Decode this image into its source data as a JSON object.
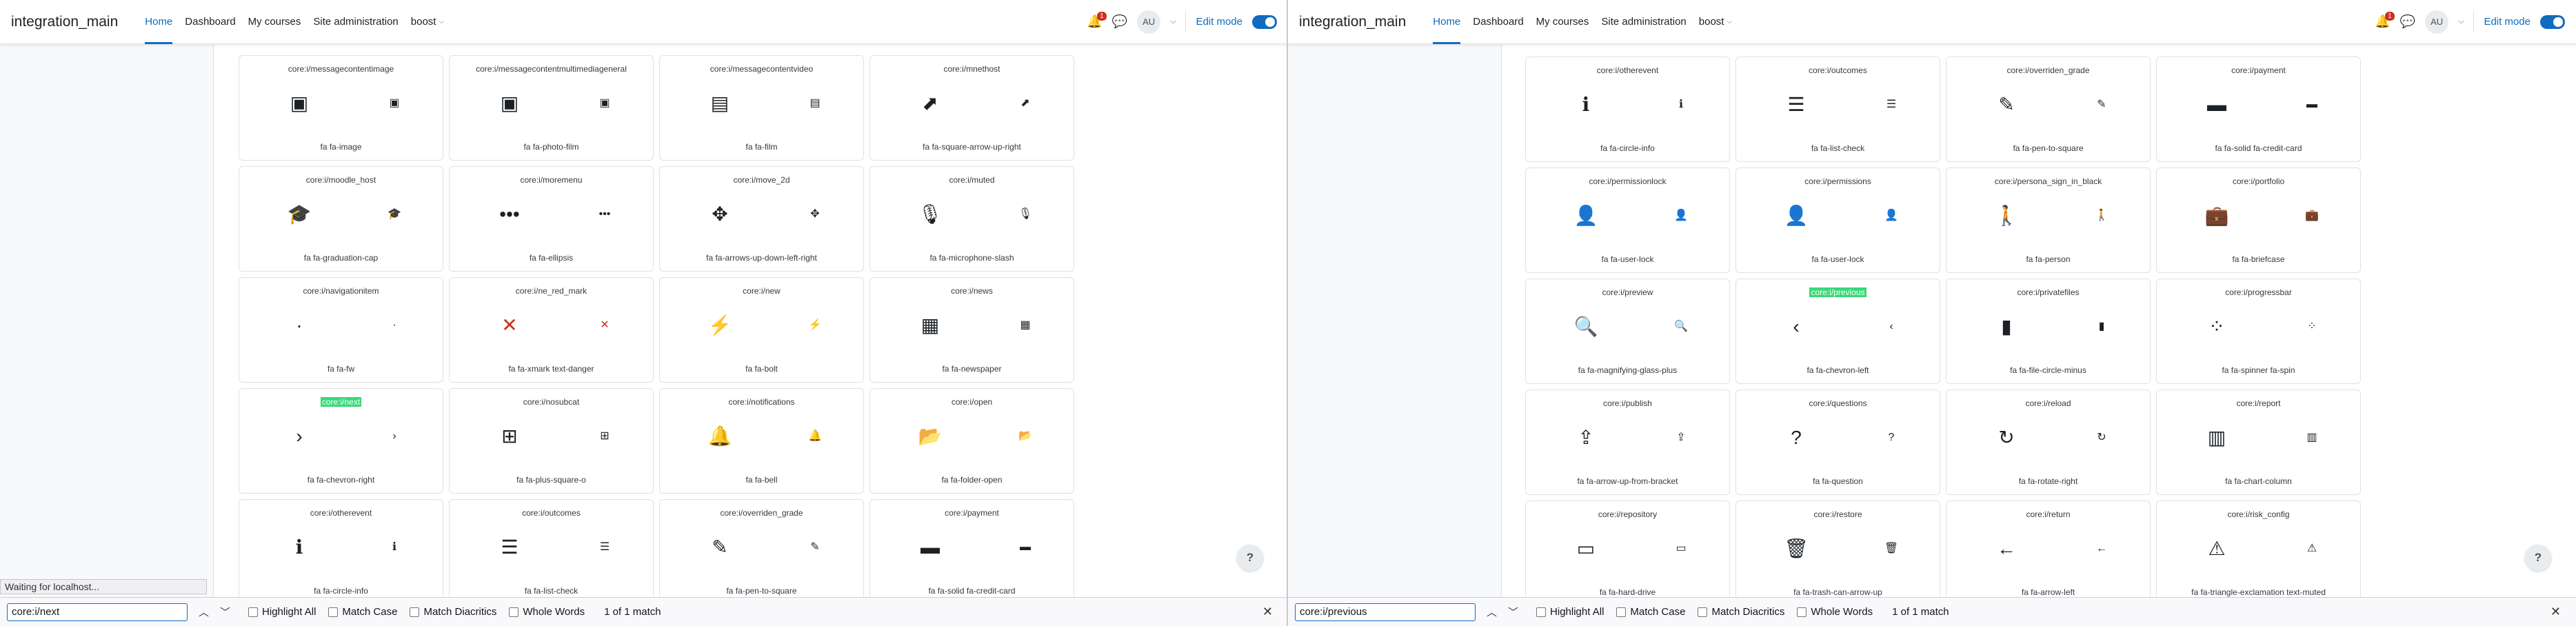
{
  "screens": [
    {
      "navbar": {
        "site_name": "integration_main",
        "items": [
          "Home",
          "Dashboard",
          "My courses",
          "Site administration",
          "boost"
        ],
        "notification_count": "1",
        "avatar_initials": "AU",
        "edit_mode_label": "Edit mode"
      },
      "status_text": "Waiting for localhost...",
      "cards": [
        {
          "name": "core:i/messagecontentimage",
          "fa": "fa fa-image",
          "glyph": "▣"
        },
        {
          "name": "core:i/messagecontentmultimediageneral",
          "fa": "fa fa-photo-film",
          "glyph": "▣"
        },
        {
          "name": "core:i/messagecontentvideo",
          "fa": "fa fa-film",
          "glyph": "▤"
        },
        {
          "name": "core:i/mnethost",
          "fa": "fa fa-square-arrow-up-right",
          "glyph": "⬈"
        },
        {
          "name": "core:i/moodle_host",
          "fa": "fa fa-graduation-cap",
          "glyph": "🎓"
        },
        {
          "name": "core:i/moremenu",
          "fa": "fa fa-ellipsis",
          "glyph": "•••"
        },
        {
          "name": "core:i/move_2d",
          "fa": "fa fa-arrows-up-down-left-right",
          "glyph": "✥"
        },
        {
          "name": "core:i/muted",
          "fa": "fa fa-microphone-slash",
          "glyph": "🎙"
        },
        {
          "name": "core:i/navigationitem",
          "fa": "fa fa-fw",
          "glyph": "·"
        },
        {
          "name": "core:i/ne_red_mark",
          "fa": "fa fa-xmark text-danger",
          "glyph": "✕",
          "red": true
        },
        {
          "name": "core:i/new",
          "fa": "fa fa-bolt",
          "glyph": "⚡"
        },
        {
          "name": "core:i/news",
          "fa": "fa fa-newspaper",
          "glyph": "▦"
        },
        {
          "name": "core:i/next",
          "fa": "fa fa-chevron-right",
          "glyph": "›",
          "highlight": true
        },
        {
          "name": "core:i/nosubcat",
          "fa": "fa fa-plus-square-o",
          "glyph": "⊞"
        },
        {
          "name": "core:i/notifications",
          "fa": "fa fa-bell",
          "glyph": "🔔"
        },
        {
          "name": "core:i/open",
          "fa": "fa fa-folder-open",
          "glyph": "📂"
        },
        {
          "name": "core:i/otherevent",
          "fa": "fa fa-circle-info",
          "glyph": "ℹ"
        },
        {
          "name": "core:i/outcomes",
          "fa": "fa fa-list-check",
          "glyph": "☰"
        },
        {
          "name": "core:i/overriden_grade",
          "fa": "fa fa-pen-to-square",
          "glyph": "✎"
        },
        {
          "name": "core:i/payment",
          "fa": "fa fa-solid fa-credit-card",
          "glyph": "▬"
        }
      ],
      "find": {
        "query": "core:i/next",
        "highlight_all": "Highlight All",
        "match_case": "Match Case",
        "match_diacritics": "Match Diacritics",
        "whole_words": "Whole Words",
        "matches": "1 of 1 match"
      }
    },
    {
      "navbar": {
        "site_name": "integration_main",
        "items": [
          "Home",
          "Dashboard",
          "My courses",
          "Site administration",
          "boost"
        ],
        "notification_count": "1",
        "avatar_initials": "AU",
        "edit_mode_label": "Edit mode"
      },
      "status_text": "",
      "cards": [
        {
          "name": "core:i/otherevent",
          "fa": "fa fa-circle-info",
          "glyph": "ℹ"
        },
        {
          "name": "core:i/outcomes",
          "fa": "fa fa-list-check",
          "glyph": "☰"
        },
        {
          "name": "core:i/overriden_grade",
          "fa": "fa fa-pen-to-square",
          "glyph": "✎"
        },
        {
          "name": "core:i/payment",
          "fa": "fa fa-solid fa-credit-card",
          "glyph": "▬"
        },
        {
          "name": "core:i/permissionlock",
          "fa": "fa fa-user-lock",
          "glyph": "👤"
        },
        {
          "name": "core:i/permissions",
          "fa": "fa fa-user-lock",
          "glyph": "👤"
        },
        {
          "name": "core:i/persona_sign_in_black",
          "fa": "fa fa-person",
          "glyph": "🚶"
        },
        {
          "name": "core:i/portfolio",
          "fa": "fa fa-briefcase",
          "glyph": "💼"
        },
        {
          "name": "core:i/preview",
          "fa": "fa fa-magnifying-glass-plus",
          "glyph": "🔍"
        },
        {
          "name": "core:i/previous",
          "fa": "fa fa-chevron-left",
          "glyph": "‹",
          "highlight": true
        },
        {
          "name": "core:i/privatefiles",
          "fa": "fa fa-file-circle-minus",
          "glyph": "▮"
        },
        {
          "name": "core:i/progressbar",
          "fa": "fa fa-spinner fa-spin",
          "glyph": "⁘"
        },
        {
          "name": "core:i/publish",
          "fa": "fa fa-arrow-up-from-bracket",
          "glyph": "⇪"
        },
        {
          "name": "core:i/questions",
          "fa": "fa fa-question",
          "glyph": "?"
        },
        {
          "name": "core:i/reload",
          "fa": "fa fa-rotate-right",
          "glyph": "↻"
        },
        {
          "name": "core:i/report",
          "fa": "fa fa-chart-column",
          "glyph": "▥"
        },
        {
          "name": "core:i/repository",
          "fa": "fa fa-hard-drive",
          "glyph": "▭"
        },
        {
          "name": "core:i/restore",
          "fa": "fa fa-trash-can-arrow-up",
          "glyph": "🗑"
        },
        {
          "name": "core:i/return",
          "fa": "fa fa-arrow-left",
          "glyph": "←"
        },
        {
          "name": "core:i/risk_config",
          "fa": "fa fa-triangle-exclamation text-muted",
          "glyph": "⚠"
        }
      ],
      "find": {
        "query": "core:i/previous",
        "highlight_all": "Highlight All",
        "match_case": "Match Case",
        "match_diacritics": "Match Diacritics",
        "whole_words": "Whole Words",
        "matches": "1 of 1 match"
      }
    }
  ]
}
